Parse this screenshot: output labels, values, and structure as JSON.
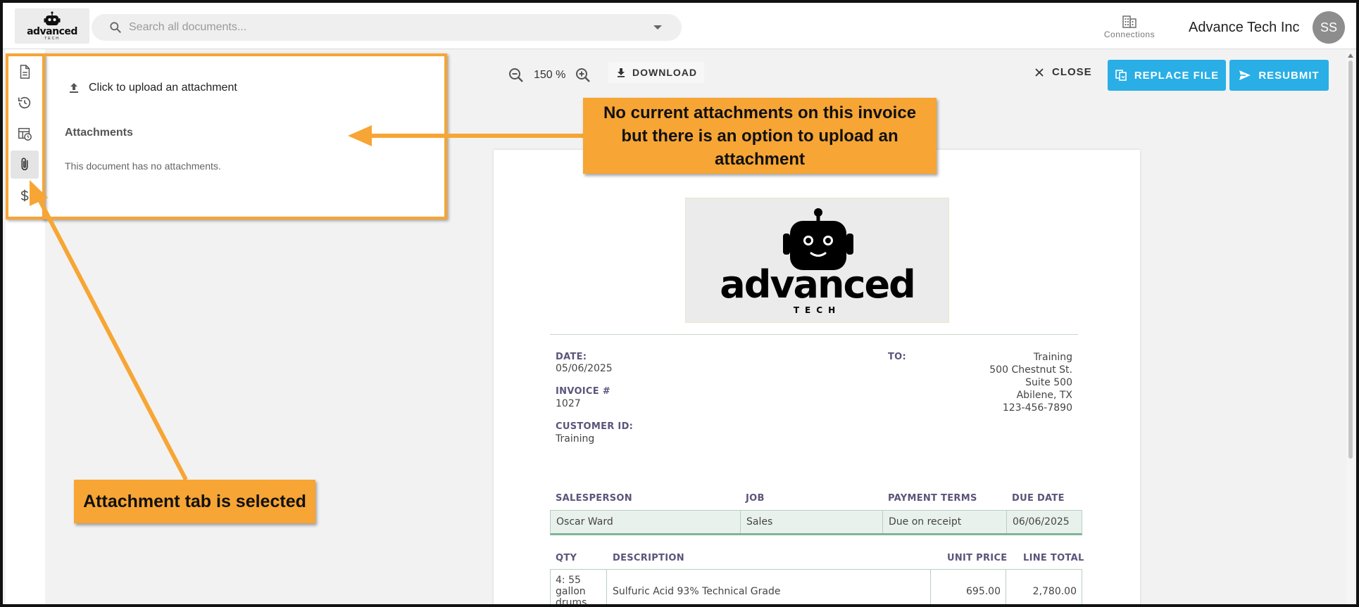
{
  "header": {
    "logo_word": "advanced",
    "logo_sub": "TECH",
    "search_placeholder": "Search all documents...",
    "connections_label": "Connections",
    "company_name": "Advance Tech Inc",
    "avatar_initials": "SS"
  },
  "rail": {
    "items": [
      {
        "icon": "document-icon",
        "active": false
      },
      {
        "icon": "history-icon",
        "active": false
      },
      {
        "icon": "table-clock-icon",
        "active": false
      },
      {
        "icon": "paperclip-icon",
        "active": true
      },
      {
        "icon": "dollar-icon",
        "active": false
      }
    ]
  },
  "panel": {
    "upload_label": "Click to upload an attachment",
    "heading": "Attachments",
    "empty_message": "This document has no attachments."
  },
  "toolbar": {
    "zoom_value": "150 %",
    "download_label": "DOWNLOAD",
    "close_label": "CLOSE",
    "replace_label": "REPLACE FILE",
    "resubmit_label": "RESUBMIT"
  },
  "invoice": {
    "logo_word": "advanced",
    "logo_sub": "TECH",
    "date_label": "DATE:",
    "date_value": "05/06/2025",
    "invoice_label": "INVOICE #",
    "invoice_value": "1027",
    "customer_label": "CUSTOMER ID:",
    "customer_value": "Training",
    "to_label": "TO:",
    "to_lines": [
      "Training",
      "500 Chestnut St.",
      "Suite 500",
      "Abilene, TX",
      "123-456-7890"
    ],
    "sales_headers": [
      "SALESPERSON",
      "JOB",
      "PAYMENT TERMS",
      "DUE DATE"
    ],
    "sales_values": [
      "Oscar Ward",
      "Sales",
      "Due on receipt",
      "06/06/2025"
    ],
    "item_headers": [
      "QTY",
      "DESCRIPTION",
      "UNIT PRICE",
      "LINE TOTAL"
    ],
    "item_qty": "4: 55 gallon drums",
    "item_description": "Sulfuric Acid 93% Technical Grade",
    "item_unit_price": "695.00",
    "item_line_total": "2,780.00"
  },
  "annotations": {
    "top_callout": "No current attachments on this invoice but there is an option to upload an attachment",
    "bottom_callout": "Attachment tab is selected",
    "color": "#f7a534"
  },
  "colors": {
    "primary_button": "#29aee6",
    "label_purple": "#5a557a",
    "table_fill": "#e9f1ec"
  }
}
